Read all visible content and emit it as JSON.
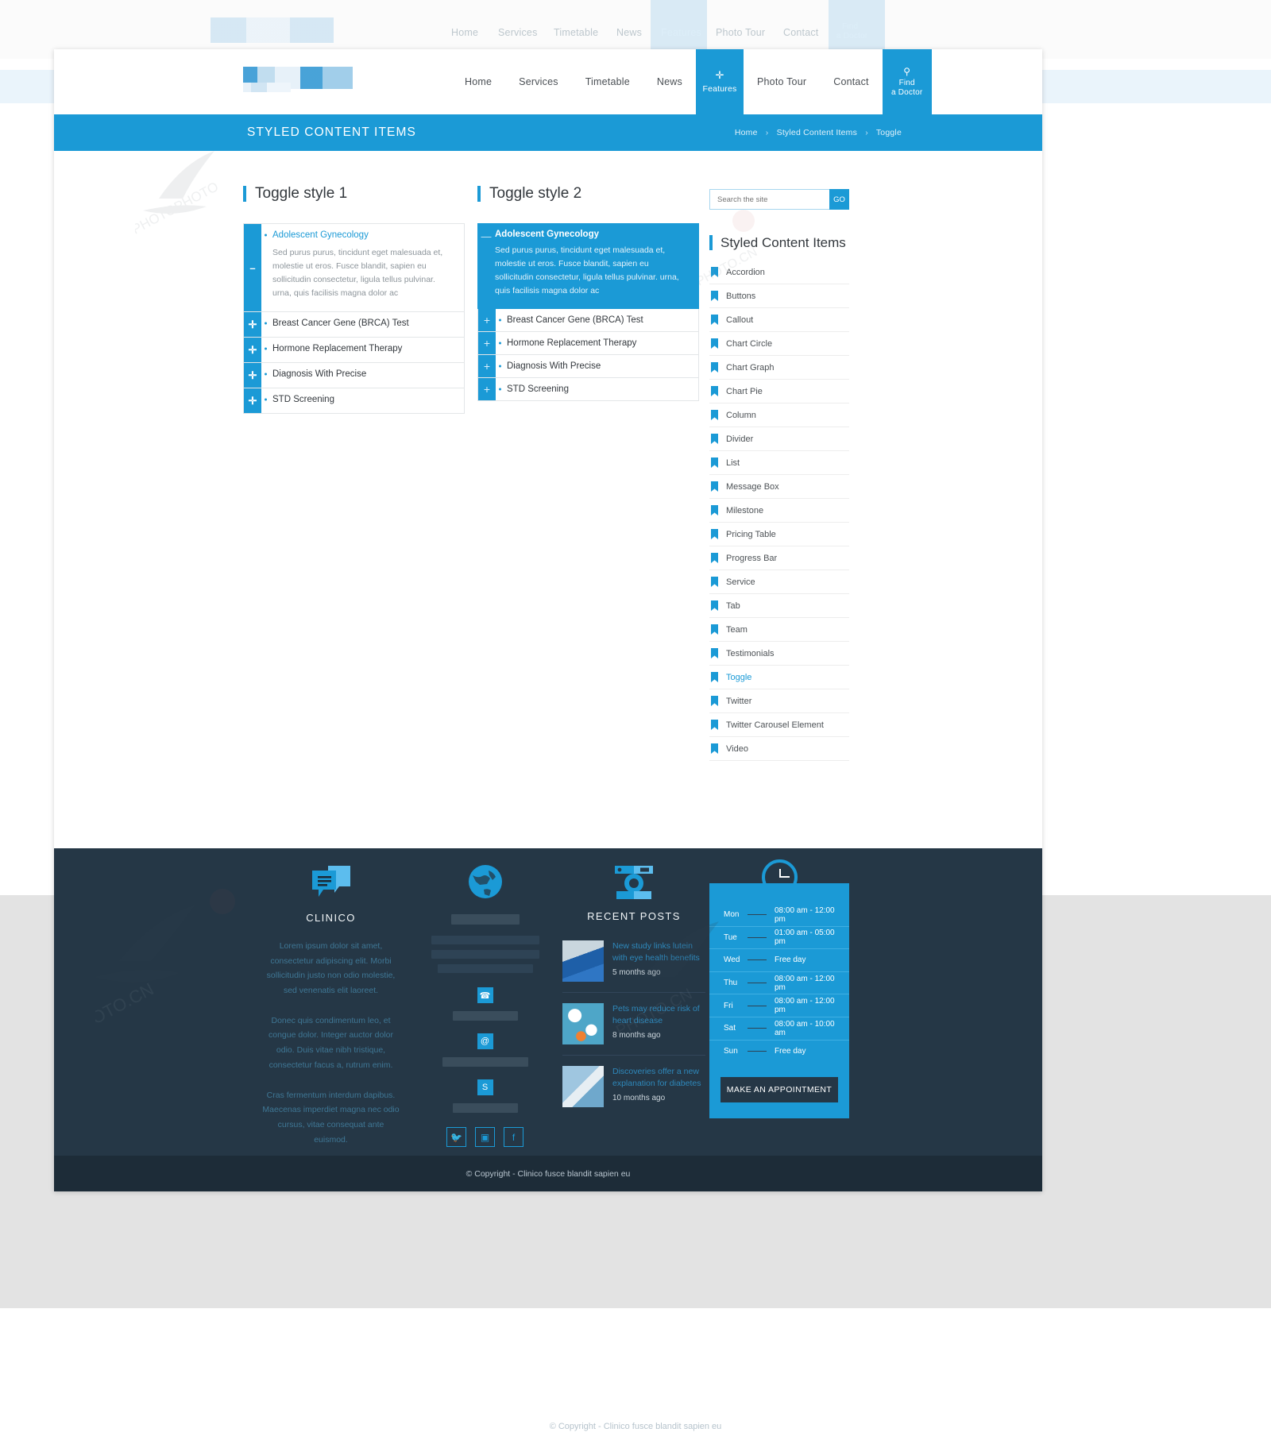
{
  "ghost_nav": {
    "items": [
      "Home",
      "Services",
      "Timetable",
      "News",
      "Features",
      "Photo Tour",
      "Contact"
    ],
    "find_doctor_line1": "Find",
    "find_doctor_line2": "a Doctor"
  },
  "header": {
    "nav": [
      {
        "label": "Home",
        "type": "plain"
      },
      {
        "label": "Services",
        "type": "plain"
      },
      {
        "label": "Timetable",
        "type": "plain"
      },
      {
        "label": "News",
        "type": "plain"
      },
      {
        "label": "Features",
        "type": "box",
        "icon": "plus-icon"
      },
      {
        "label": "Photo Tour",
        "type": "plain"
      },
      {
        "label": "Contact",
        "type": "plain"
      }
    ],
    "find_doctor": {
      "icon": "search-icon",
      "line1": "Find",
      "line2": "a Doctor"
    }
  },
  "titlebar": {
    "page_title": "STYLED CONTENT ITEMS",
    "breadcrumbs": [
      "Home",
      "Styled Content Items",
      "Toggle"
    ],
    "separator": "›"
  },
  "toggle1": {
    "heading": "Toggle style 1",
    "items": [
      {
        "title": "Adolescent Gynecology",
        "open": true,
        "icon": "minus-icon",
        "body": "Sed purus purus, tincidunt eget malesuada et, molestie ut eros. Fusce blandit, sapien eu sollicitudin consectetur, ligula tellus pulvinar. urna, quis facilisis magna dolor ac"
      },
      {
        "title": "Breast Cancer Gene (BRCA) Test",
        "open": false,
        "icon": "plus-icon"
      },
      {
        "title": "Hormone Replacement Therapy",
        "open": false,
        "icon": "plus-icon"
      },
      {
        "title": "Diagnosis With Precise",
        "open": false,
        "icon": "plus-icon"
      },
      {
        "title": "STD Screening",
        "open": false,
        "icon": "plus-icon"
      }
    ]
  },
  "toggle2": {
    "heading": "Toggle style 2",
    "items": [
      {
        "title": "Adolescent Gynecology",
        "open": true,
        "icon": "minus-icon",
        "body": "Sed purus purus, tincidunt eget malesuada et, molestie ut eros. Fusce blandit, sapien eu sollicitudin consectetur, ligula tellus pulvinar. urna, quis facilisis magna dolor ac"
      },
      {
        "title": "Breast Cancer Gene (BRCA) Test",
        "open": false,
        "icon": "plus-icon"
      },
      {
        "title": "Hormone Replacement Therapy",
        "open": false,
        "icon": "plus-icon"
      },
      {
        "title": "Diagnosis With Precise",
        "open": false,
        "icon": "plus-icon"
      },
      {
        "title": "STD Screening",
        "open": false,
        "icon": "plus-icon"
      }
    ]
  },
  "sidebar": {
    "search": {
      "placeholder": "Search the site",
      "button": "GO"
    },
    "title": "Styled Content Items",
    "items": [
      {
        "label": "Accordion",
        "active": false
      },
      {
        "label": "Buttons",
        "active": false
      },
      {
        "label": "Callout",
        "active": false
      },
      {
        "label": "Chart Circle",
        "active": false
      },
      {
        "label": "Chart Graph",
        "active": false
      },
      {
        "label": "Chart Pie",
        "active": false
      },
      {
        "label": "Column",
        "active": false
      },
      {
        "label": "Divider",
        "active": false
      },
      {
        "label": "List",
        "active": false
      },
      {
        "label": "Message Box",
        "active": false
      },
      {
        "label": "Milestone",
        "active": false
      },
      {
        "label": "Pricing Table",
        "active": false
      },
      {
        "label": "Progress Bar",
        "active": false
      },
      {
        "label": "Service",
        "active": false
      },
      {
        "label": "Tab",
        "active": false
      },
      {
        "label": "Team",
        "active": false
      },
      {
        "label": "Testimonials",
        "active": false
      },
      {
        "label": "Toggle",
        "active": true
      },
      {
        "label": "Twitter",
        "active": false
      },
      {
        "label": "Twitter Carousel Element",
        "active": false
      },
      {
        "label": "Video",
        "active": false
      }
    ]
  },
  "footer": {
    "about": {
      "icon": "chat-bubbles-icon",
      "title": "CLINICO",
      "paragraphs": [
        "Lorem ipsum dolor sit amet, consectetur adipiscing elit. Morbi sollicitudin justo non odio molestie, sed venenatis elit laoreet.",
        "Donec quis condimentum leo, et congue dolor. Integer auctor dolor odio. Duis vitae nibh tristique, consectetur facus a, rutrum enim.",
        "Cras fermentum interdum dapibus. Maecenas imperdiet magna nec odio cursus, vitae consequat ante euismod."
      ]
    },
    "contact": {
      "icon": "globe-icon",
      "phone_icon": "phone-icon",
      "email_icon": "at-icon",
      "skype_icon": "skype-icon",
      "socials": [
        {
          "icon": "twitter-icon",
          "glyph": "🐦"
        },
        {
          "icon": "instagram-icon",
          "glyph": "▣"
        },
        {
          "icon": "facebook-icon",
          "glyph": "f"
        }
      ]
    },
    "recent_posts": {
      "icon": "camera-icon",
      "title": "RECENT POSTS",
      "posts": [
        {
          "title": "New study links lutein with eye health benefits",
          "ago": "5 months ago",
          "thumb": "surgeon-photo"
        },
        {
          "title": "Pets may reduce risk of heart disease",
          "ago": "8 months ago",
          "thumb": "pills-photo"
        },
        {
          "title": "Discoveries offer a new explanation for diabetes",
          "ago": "10 months ago",
          "thumb": "syringe-photo"
        }
      ]
    },
    "hours": {
      "icon": "clock-icon",
      "rows": [
        {
          "day": "Mon",
          "value": "08:00 am - 12:00 pm"
        },
        {
          "day": "Tue",
          "value": "01:00 am - 05:00 pm"
        },
        {
          "day": "Wed",
          "value": "Free day"
        },
        {
          "day": "Thu",
          "value": "08:00 am - 12:00 pm"
        },
        {
          "day": "Fri",
          "value": "08:00 am - 12:00 pm"
        },
        {
          "day": "Sat",
          "value": "08:00 am - 10:00 am"
        },
        {
          "day": "Sun",
          "value": "Free day"
        }
      ],
      "button": "MAKE AN APPOINTMENT"
    },
    "copyright": "© Copyright - Clinico  fusce blandit sapien eu"
  },
  "page_bottom_copyright": "© Copyright - Clinico  fusce blandit sapien eu",
  "colors": {
    "accent": "#1b9ad6",
    "footer_bg": "#253746",
    "copyright_bg": "#1d2c38",
    "text": "#33383d",
    "muted": "#8d959b"
  }
}
